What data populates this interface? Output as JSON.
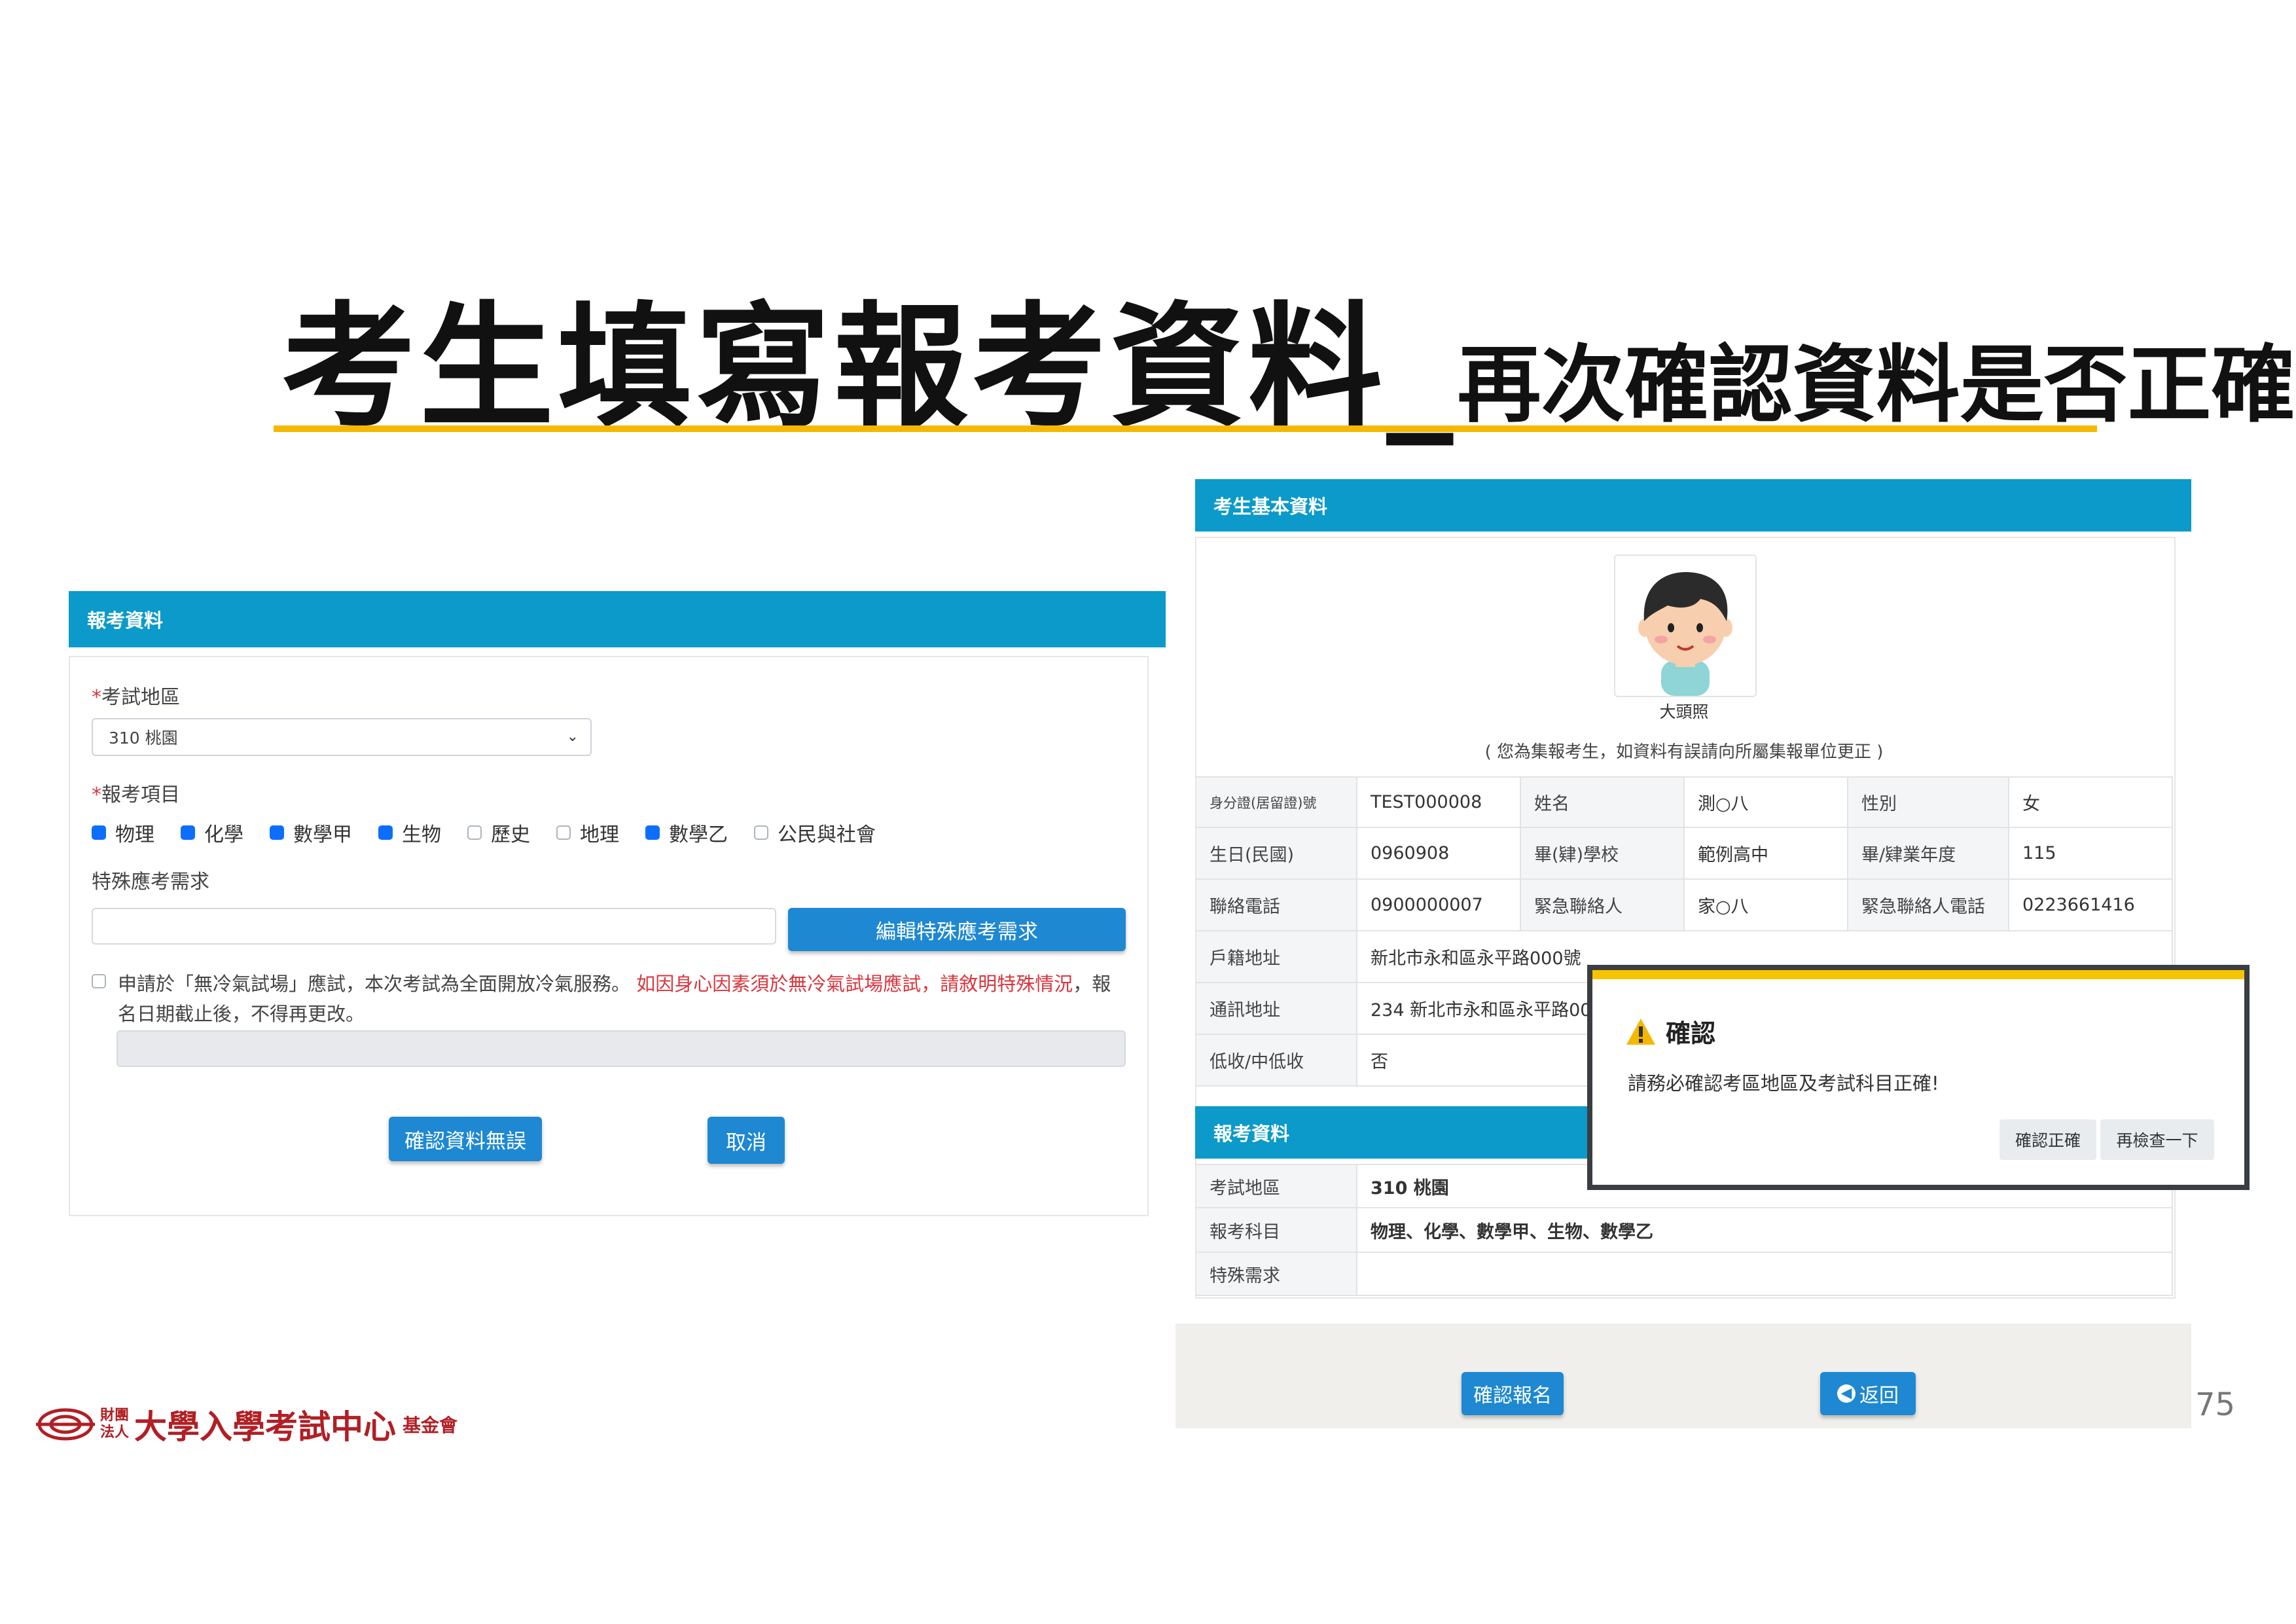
{
  "slide": {
    "title_main": "考生填寫報考資料_",
    "title_sub": "再次確認資料是否正確",
    "page_number": "75",
    "accent_color": "#f5b800"
  },
  "left_form": {
    "header": "報考資料",
    "region_label": "考試地區",
    "region_value": "310 桃園",
    "subjects_label": "報考項目",
    "subjects": [
      {
        "name": "物理",
        "checked": true
      },
      {
        "name": "化學",
        "checked": true
      },
      {
        "name": "數學甲",
        "checked": true
      },
      {
        "name": "生物",
        "checked": true
      },
      {
        "name": "歷史",
        "checked": false
      },
      {
        "name": "地理",
        "checked": false
      },
      {
        "name": "數學乙",
        "checked": true
      },
      {
        "name": "公民與社會",
        "checked": false
      }
    ],
    "special_label": "特殊應考需求",
    "edit_special_button": "編輯特殊應考需求",
    "aircon_text": "申請於「無冷氣試場」應試，本次考試為全面開放冷氣服務。",
    "aircon_red": "如因身心因素須於無冷氣試場應試，請敘明特殊情況",
    "aircon_tail": "，報名日期截止後，不得再更改。",
    "confirm_button": "確認資料無誤",
    "cancel_button": "取消"
  },
  "right_panel": {
    "header": "考生基本資料",
    "photo_caption": "大頭照",
    "notice": "( 您為集報考生，如資料有誤請向所屬集報單位更正 )",
    "rows": [
      [
        "身分證(居留證)號",
        "TEST000008",
        "姓名",
        "測○八",
        "性別",
        "女"
      ],
      [
        "生日(民國)",
        "0960908",
        "畢(肄)學校",
        "範例高中",
        "畢/肄業年度",
        "115"
      ],
      [
        "聯絡電話",
        "0900000007",
        "緊急聯絡人",
        "家○八",
        "緊急聯絡人電話",
        "0223661416"
      ]
    ],
    "address_rows": [
      [
        "戶籍地址",
        "新北市永和區永平路000號"
      ],
      [
        "通訊地址",
        "234 新北市永和區永平路000號"
      ],
      [
        "低收/中低收",
        "否"
      ]
    ],
    "exam_header": "報考資料",
    "exam_rows": [
      [
        "考試地區",
        "310 桃園"
      ],
      [
        "報考科目",
        "物理、化學、數學甲、生物、數學乙"
      ],
      [
        "特殊需求",
        ""
      ]
    ],
    "confirm_signup_button": "確認報名",
    "back_button": "返回"
  },
  "modal": {
    "title": "確認",
    "message": "請務必確認考區地區及考試科目正確!",
    "confirm_button": "確認正確",
    "recheck_button": "再檢查一下"
  },
  "logo": {
    "small_top": "財團",
    "small_bottom": "法人",
    "name": "大學入學考試中心",
    "suffix": "基金會"
  }
}
